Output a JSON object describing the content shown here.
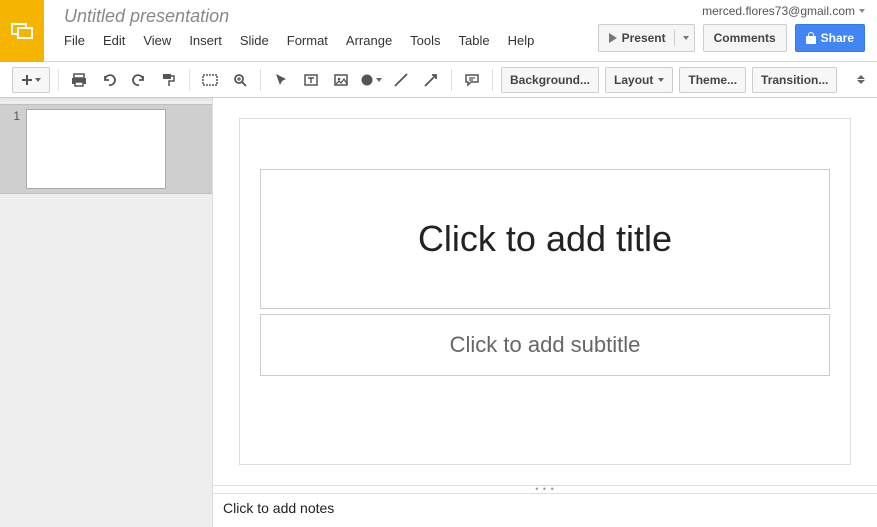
{
  "header": {
    "doc_title": "Untitled presentation",
    "user_email": "merced.flores73@gmail.com",
    "buttons": {
      "present": "Present",
      "comments": "Comments",
      "share": "Share"
    }
  },
  "menubar": {
    "file": "File",
    "edit": "Edit",
    "view": "View",
    "insert": "Insert",
    "slide": "Slide",
    "format": "Format",
    "arrange": "Arrange",
    "tools": "Tools",
    "table": "Table",
    "help": "Help"
  },
  "toolbar": {
    "background": "Background...",
    "layout": "Layout",
    "theme": "Theme...",
    "transition": "Transition..."
  },
  "side": {
    "slide_number": "1"
  },
  "slide": {
    "title_placeholder": "Click to add title",
    "subtitle_placeholder": "Click to add subtitle"
  },
  "notes": {
    "placeholder": "Click to add notes"
  }
}
